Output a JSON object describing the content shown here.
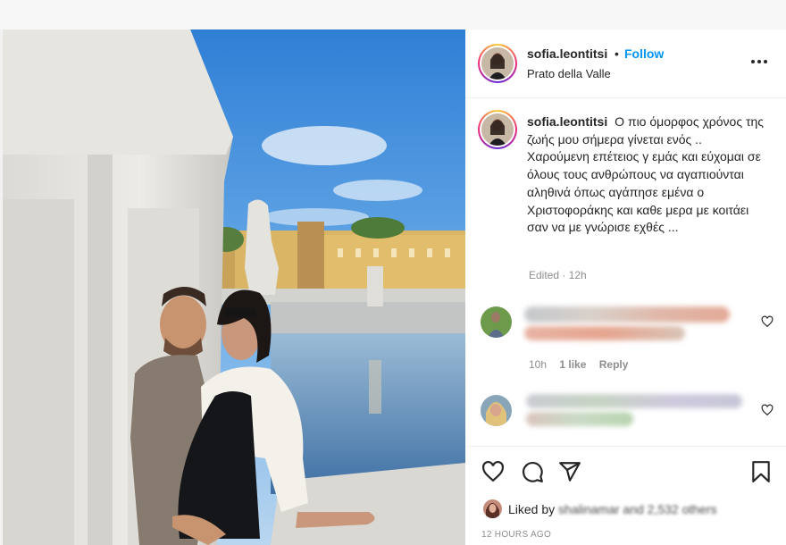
{
  "post": {
    "username": "sofia.leontitsi",
    "follow_label": "Follow",
    "separator": "•",
    "location": "Prato della Valle",
    "more_label": "•••"
  },
  "caption": {
    "username": "sofia.leontitsi",
    "text": "Ο πιο όμορφος χρόνος της ζωής μου σήμερα γίνεται ενός .. Χαρούμενη επέτειος γ εμάς και εύχομαι σε όλους τους ανθρώπους να αγαπιούνται αληθινά όπως αγάπησε εμένα ο Χριστοφοράκης και καθε μερα με κοιτάει σαν να με γνώρισε εχθές ...",
    "edited": "Edited · 12h"
  },
  "comments": [
    {
      "time": "10h",
      "likes": "1 like",
      "reply": "Reply"
    },
    {}
  ],
  "likes": {
    "prefix": "Liked by",
    "blurred_text": "shalinamar and 2,532 others"
  },
  "timestamp": "12 HOURS AGO",
  "colors": {
    "follow": "#0095f6",
    "muted": "#8e8e8e",
    "text": "#262626"
  },
  "icons": {
    "like": "heart-icon",
    "comment": "comment-icon",
    "share": "paper-plane-icon",
    "save": "bookmark-icon",
    "more": "more-options-icon"
  }
}
